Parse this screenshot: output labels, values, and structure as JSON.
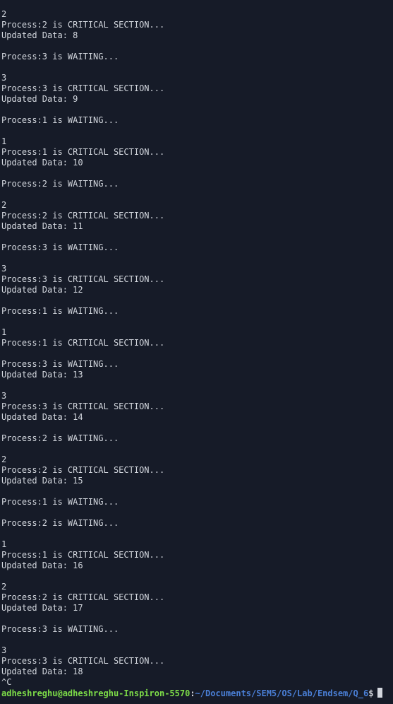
{
  "terminal": {
    "lines": [
      "2",
      "Process:2 is CRITICAL SECTION...",
      "Updated Data: 8",
      "",
      "Process:3 is WAITING...",
      "",
      "3",
      "Process:3 is CRITICAL SECTION...",
      "Updated Data: 9",
      "",
      "Process:1 is WAITING...",
      "",
      "1",
      "Process:1 is CRITICAL SECTION...",
      "Updated Data: 10",
      "",
      "Process:2 is WAITING...",
      "",
      "2",
      "Process:2 is CRITICAL SECTION...",
      "Updated Data: 11",
      "",
      "Process:3 is WAITING...",
      "",
      "3",
      "Process:3 is CRITICAL SECTION...",
      "Updated Data: 12",
      "",
      "Process:1 is WAITING...",
      "",
      "1",
      "Process:1 is CRITICAL SECTION...",
      "",
      "Process:3 is WAITING...",
      "Updated Data: 13",
      "",
      "3",
      "Process:3 is CRITICAL SECTION...",
      "Updated Data: 14",
      "",
      "Process:2 is WAITING...",
      "",
      "2",
      "Process:2 is CRITICAL SECTION...",
      "Updated Data: 15",
      "",
      "Process:1 is WAITING...",
      "",
      "Process:2 is WAITING...",
      "",
      "1",
      "Process:1 is CRITICAL SECTION...",
      "Updated Data: 16",
      "",
      "2",
      "Process:2 is CRITICAL SECTION...",
      "Updated Data: 17",
      "",
      "Process:3 is WAITING...",
      "",
      "3",
      "Process:3 is CRITICAL SECTION...",
      "Updated Data: 18",
      "^C"
    ],
    "prompt": {
      "user_host": "adheshreghu@adheshreghu-Inspiron-5570",
      "separator": ":",
      "cwd": "~/Documents/SEM5/OS/Lab/Endsem/Q_6",
      "symbol": "$"
    },
    "colors": {
      "background": "#161b28",
      "text": "#d3d7de",
      "user_host": "#7ddc48",
      "cwd": "#4a7fd6"
    }
  }
}
